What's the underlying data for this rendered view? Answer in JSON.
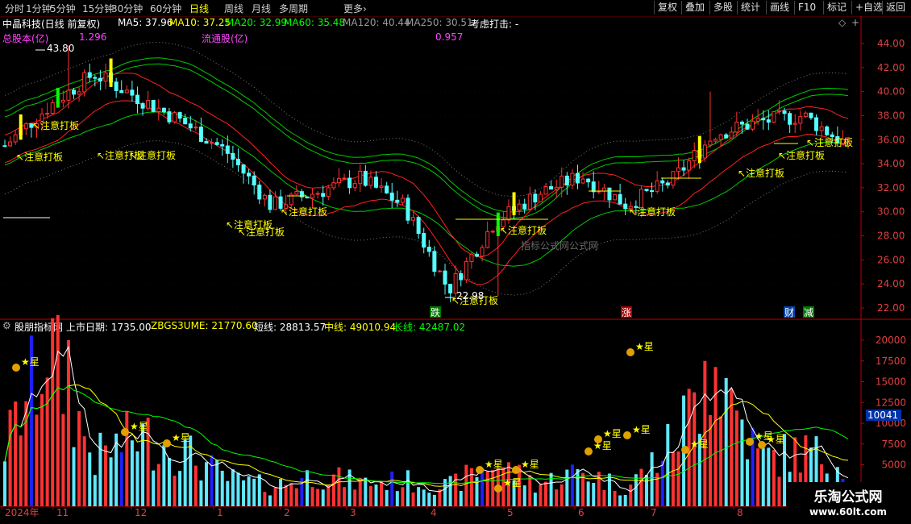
{
  "toolbar": {
    "periods": [
      "分时",
      "1分钟",
      "5分钟",
      "15分钟",
      "30分钟",
      "60分钟",
      "日线",
      "周线",
      "月线",
      "多周期",
      "更多›"
    ],
    "active_period": "日线",
    "right_buttons": [
      "复权",
      "叠加",
      "多股",
      "统计",
      "画线",
      "F10",
      "标记",
      "+自选",
      "返回"
    ]
  },
  "main_info": {
    "stock": "中晶科技(日线 前复权)",
    "ma5": "MA5: 37.96",
    "ma10": "MA10: 37.25",
    "ma20": "MA20: 32.99",
    "ma60": "MA60: 35.48",
    "ma120": "MA120: 40.44",
    "ma250": "MA250: 30.51",
    "signal": "考虑打击: -"
  },
  "share_info": {
    "total_label": "总股本(亿)",
    "total_value": "1.296",
    "float_label": "流通股(亿)",
    "float_value": "0.957"
  },
  "sub_info": {
    "name": "股朋指标网",
    "listing": "上市日期: 1735.00",
    "zbgs": "ZBGS3UME: 21770.60",
    "short": "短线: 28813.57",
    "mid": "中线: 49010.94",
    "long": "长线: 42487.02"
  },
  "annotations": {
    "zhuyi": "注意打板",
    "max_price": "43.80",
    "min_price": "22.98",
    "watermark_center": "指标公式网公式网",
    "die": "跌",
    "zhang": "涨",
    "cai": "财",
    "jian": "减",
    "xing": "★星",
    "vol_tag": "10041"
  },
  "watermark": {
    "line1": "乐淘公式网",
    "line2": "www.60lt.com"
  },
  "colors": {
    "up": "#ff3232",
    "down": "#54ffff",
    "ma_yellow": "#ffff00",
    "green": "#00cc00",
    "red_band": "#ff2020",
    "white_band": "#ffffff",
    "grid": "#8b0000",
    "axis": "#c00000"
  },
  "chart_data": {
    "type": "candlestick",
    "price_axis": {
      "min": 22,
      "max": 44,
      "ticks": [
        22,
        24,
        26,
        28,
        30,
        32,
        34,
        36,
        38,
        40,
        42,
        44
      ]
    },
    "volume_axis": {
      "min": 0,
      "max": 21000,
      "ticks": [
        5000,
        7500,
        10000,
        12500,
        15000,
        17500,
        20000
      ]
    },
    "time_axis": [
      "2024年",
      "11",
      "12",
      "1",
      "2",
      "3",
      "4",
      "5",
      "6",
      "7",
      "8"
    ],
    "close_anchors": [
      35.5,
      38.8,
      41.5,
      39.5,
      37.5,
      35.0,
      30.5,
      31.6,
      32.8,
      30.5,
      23.5,
      29.0,
      31.5,
      33.0,
      30.6,
      32.5,
      36.5,
      37.5,
      38.0,
      35.5
    ],
    "volume_anchors": [
      7500,
      20000,
      6000,
      9000,
      7000,
      3500,
      2500,
      4000,
      3000,
      3200,
      2500,
      5500,
      2800,
      4500,
      2200,
      7800,
      18000,
      6000,
      7000,
      5000
    ],
    "marks": {
      "high": {
        "value": 43.8,
        "label": "43.80"
      },
      "low": {
        "value": 22.98,
        "label": "22.98"
      }
    }
  }
}
